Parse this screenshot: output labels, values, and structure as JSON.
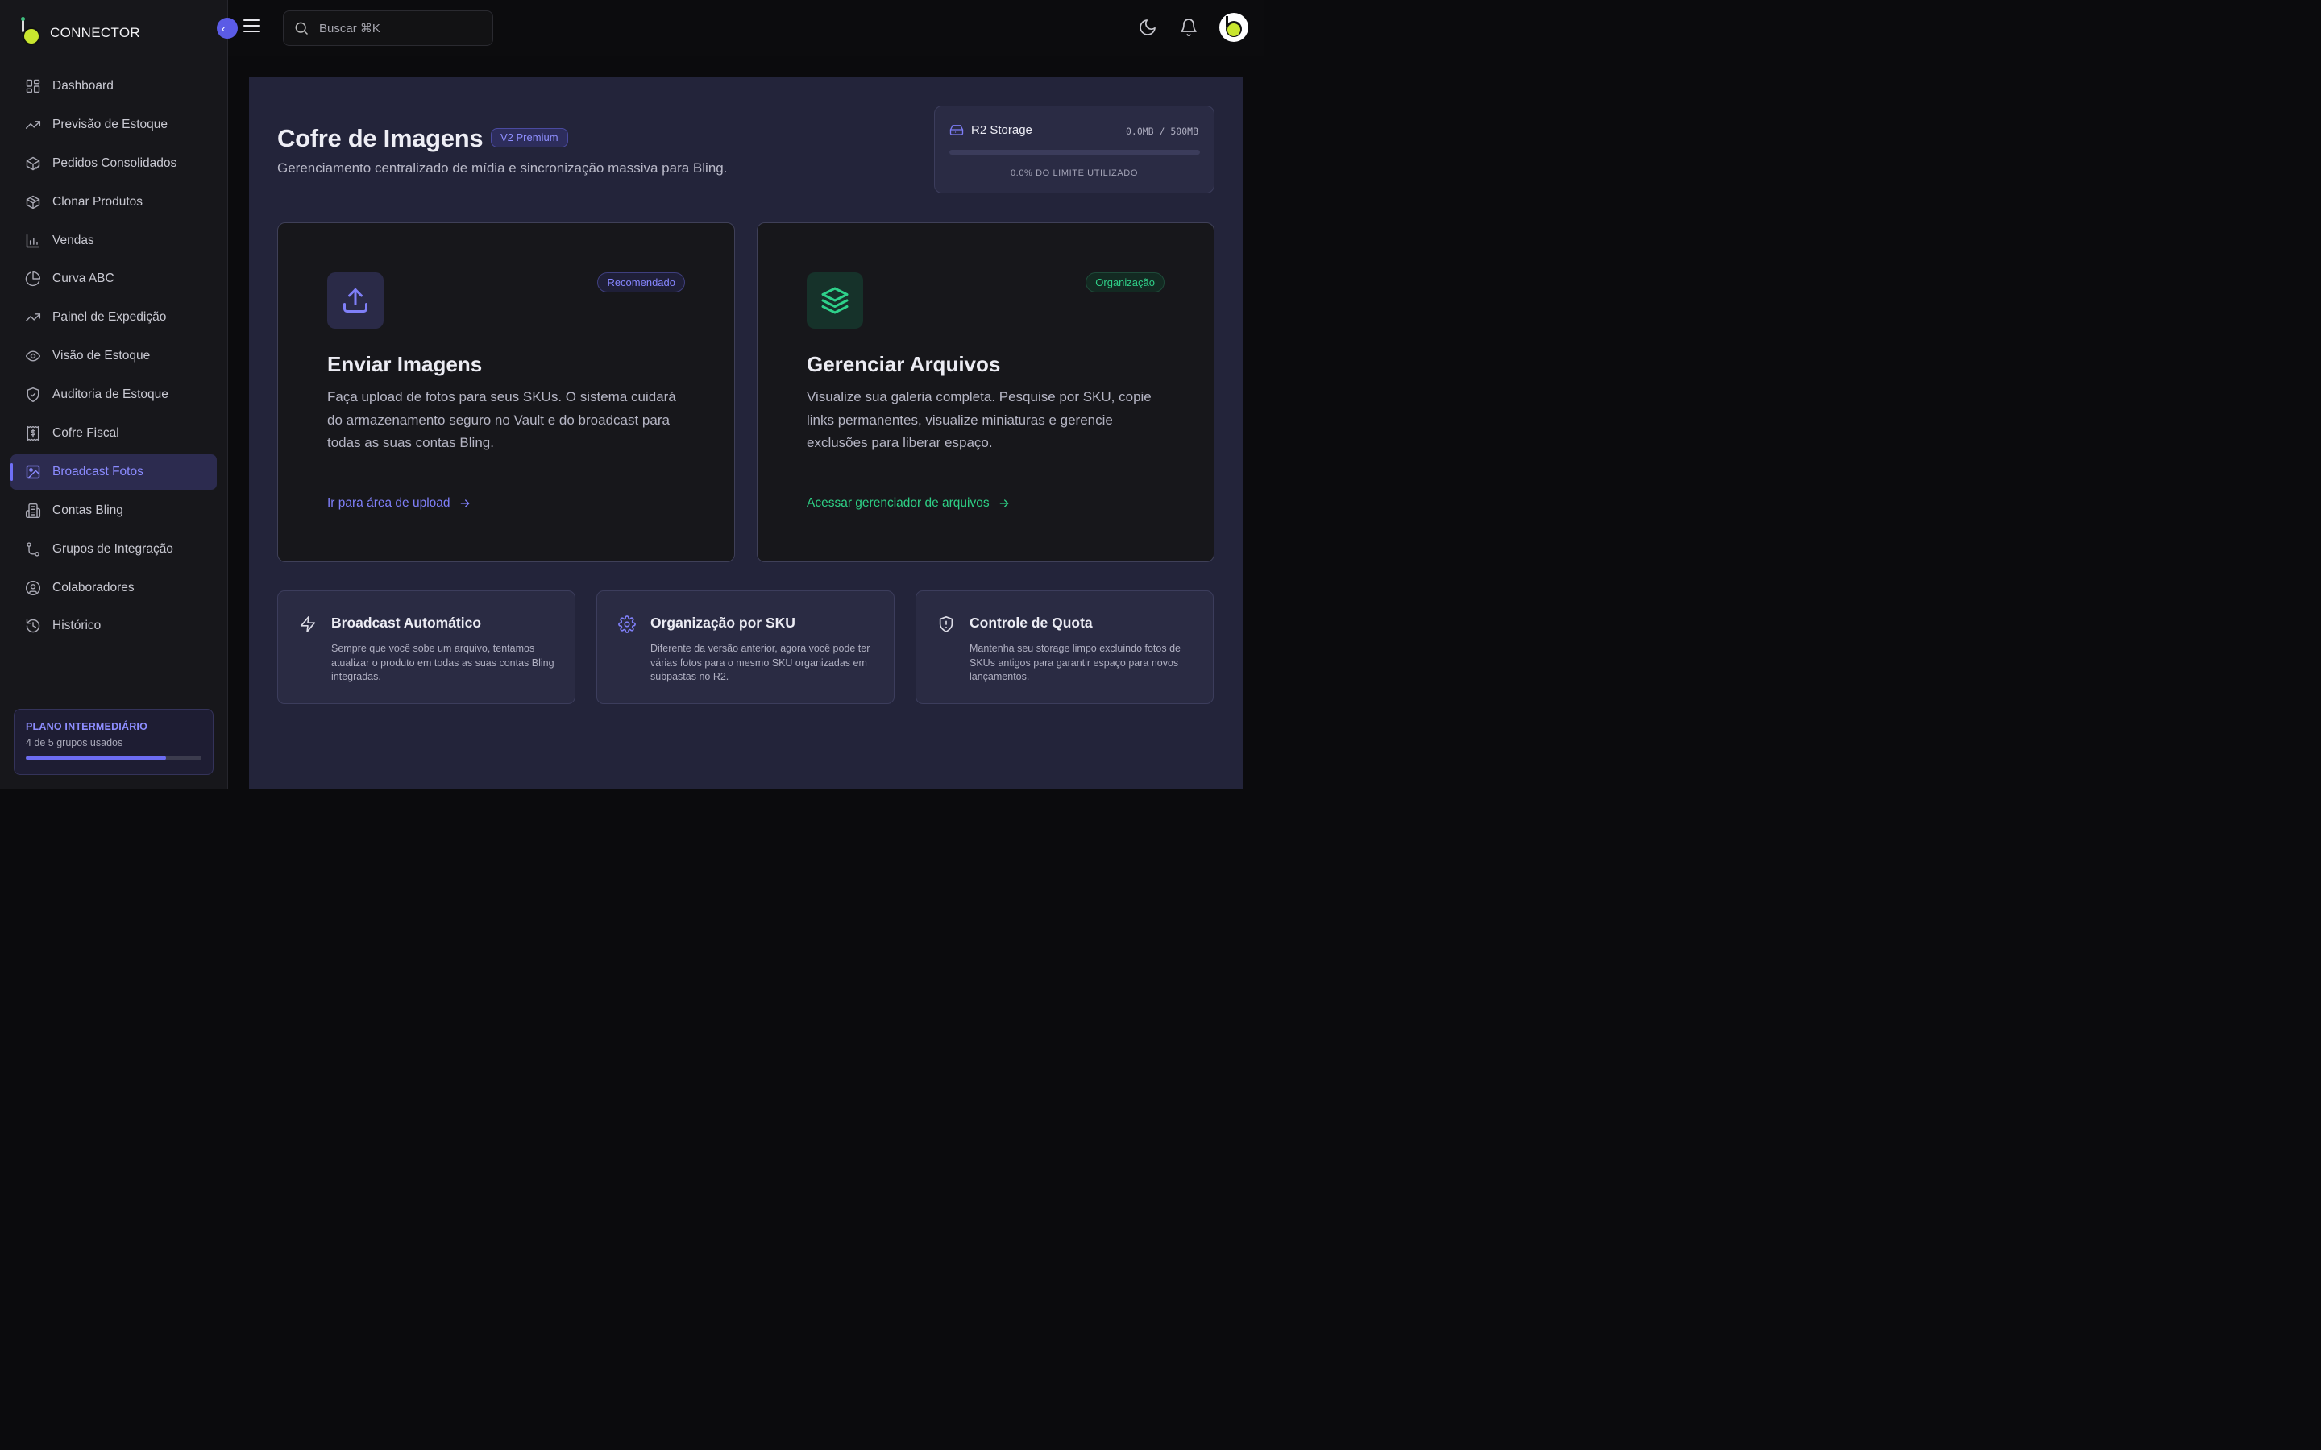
{
  "brand": {
    "name": "CONNECTOR"
  },
  "search": {
    "placeholder": "Buscar ⌘K"
  },
  "nav": [
    {
      "label": "Dashboard",
      "icon": "dashboard-grid-icon",
      "active": false
    },
    {
      "label": "Previsão de Estoque",
      "icon": "trending-up-icon",
      "active": false
    },
    {
      "label": "Pedidos Consolidados",
      "icon": "package-check-icon",
      "active": false
    },
    {
      "label": "Clonar Produtos",
      "icon": "box-icon",
      "active": false
    },
    {
      "label": "Vendas",
      "icon": "bar-chart-icon",
      "active": false
    },
    {
      "label": "Curva ABC",
      "icon": "pie-chart-icon",
      "active": false
    },
    {
      "label": "Painel de Expedição",
      "icon": "trending-up-icon",
      "active": false
    },
    {
      "label": "Visão de Estoque",
      "icon": "eye-icon",
      "active": false
    },
    {
      "label": "Auditoria de Estoque",
      "icon": "shield-check-icon",
      "active": false
    },
    {
      "label": "Cofre Fiscal",
      "icon": "receipt-icon",
      "active": false
    },
    {
      "label": "Broadcast Fotos",
      "icon": "image-icon",
      "active": true
    },
    {
      "label": "Contas Bling",
      "icon": "building-icon",
      "active": false
    },
    {
      "label": "Grupos de Integração",
      "icon": "git-branch-icon",
      "active": false
    },
    {
      "label": "Colaboradores",
      "icon": "user-circle-icon",
      "active": false
    },
    {
      "label": "Histórico",
      "icon": "history-icon",
      "active": false
    }
  ],
  "plan": {
    "title": "PLANO INTERMEDIÁRIO",
    "usage": "4 de 5 grupos usados",
    "used": 4,
    "total": 5
  },
  "page": {
    "title": "Cofre de Imagens",
    "badge": "V2 Premium",
    "subtitle": "Gerenciamento centralizado de mídia e sincronização massiva para Bling."
  },
  "storage": {
    "title": "R2 Storage",
    "usage": "0.0MB / 500MB",
    "percent_label": "0.0% DO LIMITE UTILIZADO",
    "fraction": 0.0
  },
  "cards": {
    "upload": {
      "badge": "Recomendado",
      "title": "Enviar Imagens",
      "description": "Faça upload de fotos para seus SKUs. O sistema cuidará do armazenamento seguro no Vault e do broadcast para todas as suas contas Bling.",
      "link": "Ir para área de upload"
    },
    "manage": {
      "badge": "Organização",
      "title": "Gerenciar Arquivos",
      "description": "Visualize sua galeria completa. Pesquise por SKU, copie links permanentes, visualize miniaturas e gerencie exclusões para liberar espaço.",
      "link": "Acessar gerenciador de arquivos"
    }
  },
  "features": [
    {
      "title": "Broadcast Automático",
      "description": "Sempre que você sobe um arquivo, tentamos atualizar o produto em todas as suas contas Bling integradas.",
      "icon": "zap-icon"
    },
    {
      "title": "Organização por SKU",
      "description": "Diferente da versão anterior, agora você pode ter várias fotos para o mesmo SKU organizadas em subpastas no R2.",
      "icon": "gear-icon"
    },
    {
      "title": "Controle de Quota",
      "description": "Mantenha seu storage limpo excluindo fotos de SKUs antigos para garantir espaço para novos lançamentos.",
      "icon": "shield-alert-icon"
    }
  ],
  "colors": {
    "accent": "#6c6cf2",
    "success": "#2ecf85",
    "bg": "#23243a"
  }
}
